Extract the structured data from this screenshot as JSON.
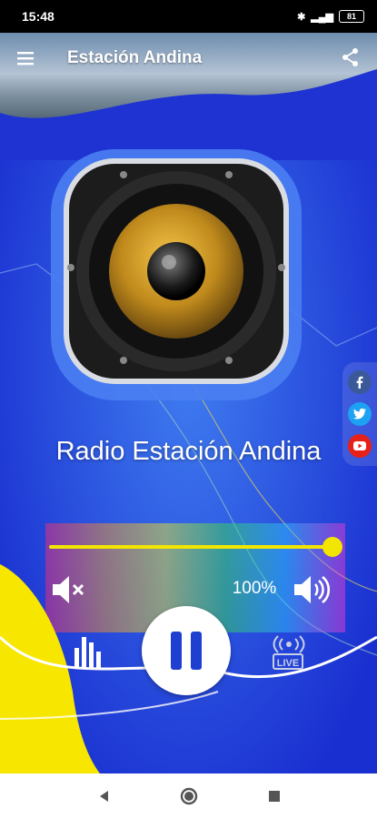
{
  "status_bar": {
    "time": "15:48",
    "battery": "81"
  },
  "app_bar": {
    "title": "Estación Andina"
  },
  "player": {
    "station_name": "Radio Estación Andina",
    "volume_percent_label": "100%",
    "volume_level": 1.0,
    "live_label": "LIVE"
  },
  "social": [
    "facebook-icon",
    "twitter-icon",
    "youtube-icon"
  ],
  "colors": {
    "background_blue": "#1a3fd6",
    "accent_yellow": "#f2e600",
    "facebook": "#3b5998",
    "twitter": "#1da1f2",
    "youtube": "#e62117"
  }
}
